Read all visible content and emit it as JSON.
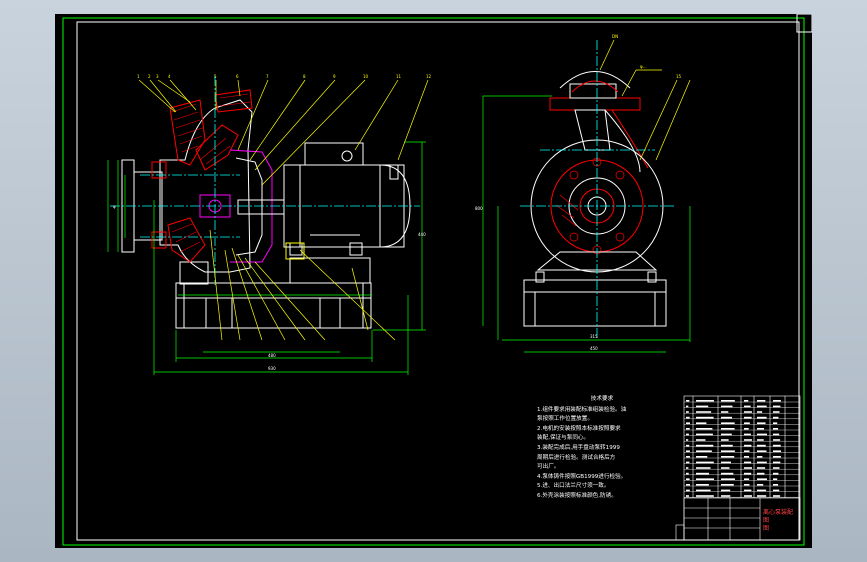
{
  "drawing": {
    "tech_title": "技术要求",
    "requirements": [
      "1.组件要求用装配标准组装检验。油",
      "  泵按照工作位置放置。",
      "2.电机的安装按照本标准按照要求",
      "  装配,保证与泵同心。",
      "3.装配完成后,用手盘动泵转1999",
      "  周期后进行检验。测试合格后方",
      "  可出厂。",
      "4.泵体铸件按照GB1999进行检验。",
      "5.进、出口法兰尺寸须一致。",
      "6.外壳涂装按照标准颜色,防锈。"
    ],
    "title_block_name": "离心泵装配图",
    "sheet_label": "图"
  },
  "colors": {
    "background": "#000000",
    "outline": "#ffffff",
    "section": "#ff0000",
    "center": "#00ffff",
    "dimension": "#00ff00",
    "leader": "#ffff00",
    "frame_outer": "#00ff00",
    "magenta": "#ff00ff"
  }
}
